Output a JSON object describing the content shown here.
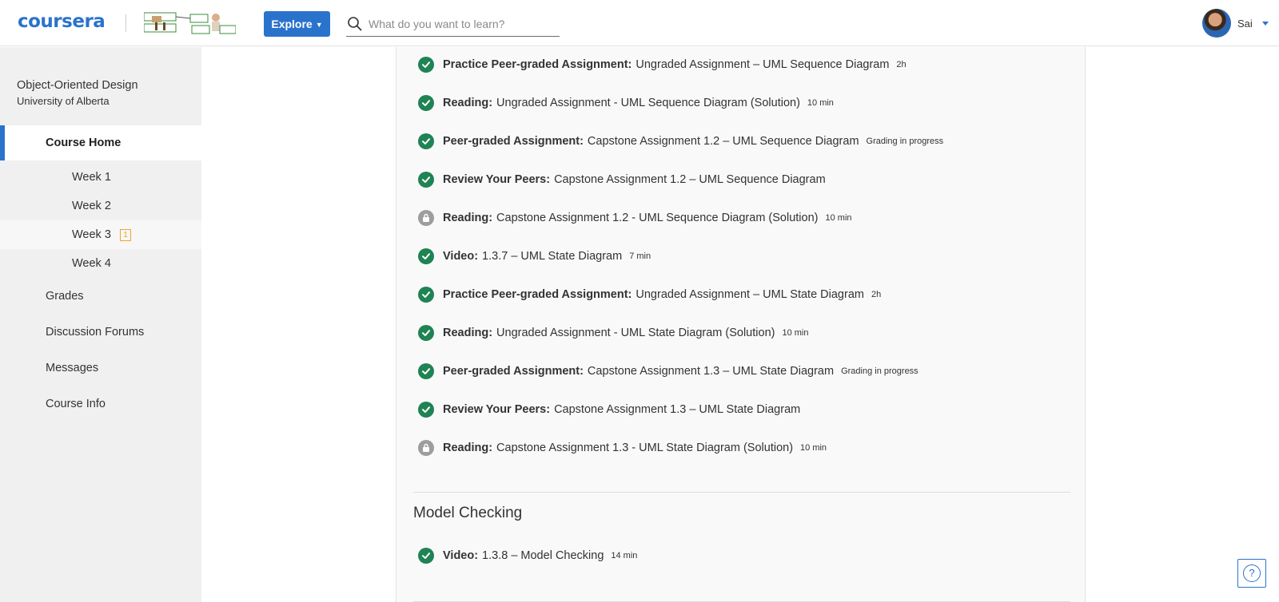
{
  "header": {
    "logo_text": "coursera",
    "explore_label": "Explore",
    "search_placeholder": "What do you want to learn?",
    "user_name": "Sai"
  },
  "sidebar": {
    "course_title": "Object-Oriented Design",
    "course_org": "University of Alberta",
    "home_label": "Course Home",
    "weeks": [
      {
        "label": "Week 1"
      },
      {
        "label": "Week 2"
      },
      {
        "label": "Week 3",
        "badge": "1"
      },
      {
        "label": "Week 4"
      }
    ],
    "links": [
      {
        "label": "Grades"
      },
      {
        "label": "Discussion Forums"
      },
      {
        "label": "Messages"
      },
      {
        "label": "Course Info"
      }
    ]
  },
  "main": {
    "items": [
      {
        "type": "Practice Peer-graded Assignment:",
        "title": "Ungraded Assignment – UML Sequence Diagram",
        "meta": "2h",
        "status": "done"
      },
      {
        "type": "Reading:",
        "title": "Ungraded Assignment - UML Sequence Diagram (Solution)",
        "meta": "10 min",
        "status": "done"
      },
      {
        "type": "Peer-graded Assignment:",
        "title": "Capstone Assignment 1.2 – UML Sequence Diagram",
        "meta": "Grading in progress",
        "status": "done"
      },
      {
        "type": "Review Your Peers:",
        "title": "Capstone Assignment 1.2 – UML Sequence Diagram",
        "meta": "",
        "status": "done"
      },
      {
        "type": "Reading:",
        "title": "Capstone Assignment 1.2 - UML Sequence Diagram (Solution)",
        "meta": "10 min",
        "status": "locked"
      },
      {
        "type": "Video:",
        "title": "1.3.7 – UML State Diagram",
        "meta": "7 min",
        "status": "done"
      },
      {
        "type": "Practice Peer-graded Assignment:",
        "title": "Ungraded Assignment – UML State Diagram",
        "meta": "2h",
        "status": "done"
      },
      {
        "type": "Reading:",
        "title": "Ungraded Assignment - UML State Diagram (Solution)",
        "meta": "10 min",
        "status": "done"
      },
      {
        "type": "Peer-graded Assignment:",
        "title": "Capstone Assignment 1.3 – UML State Diagram",
        "meta": "Grading in progress",
        "status": "done"
      },
      {
        "type": "Review Your Peers:",
        "title": "Capstone Assignment 1.3 – UML State Diagram",
        "meta": "",
        "status": "done"
      },
      {
        "type": "Reading:",
        "title": "Capstone Assignment 1.3 - UML State Diagram (Solution)",
        "meta": "10 min",
        "status": "locked"
      }
    ],
    "section_title": "Model Checking",
    "section_items": [
      {
        "type": "Video:",
        "title": "1.3.8 – Model Checking",
        "meta": "14 min",
        "status": "done"
      }
    ]
  },
  "colors": {
    "brand": "#2a73cc",
    "complete": "#1f8354",
    "locked": "#9d9d9d",
    "badge": "#f0a52a"
  },
  "icons": {
    "search": "search-icon",
    "complete": "check-circle-icon",
    "locked": "lock-icon",
    "help": "help-icon"
  }
}
